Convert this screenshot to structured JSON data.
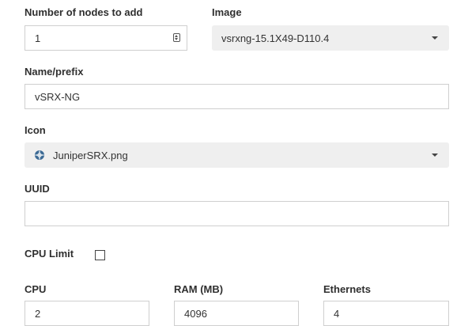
{
  "form": {
    "nodes_count": {
      "label": "Number of nodes to add",
      "value": "1"
    },
    "image": {
      "label": "Image",
      "value": "vsrxng-15.1X49-D110.4"
    },
    "name_prefix": {
      "label": "Name/prefix",
      "value": "vSRX-NG"
    },
    "icon": {
      "label": "Icon",
      "value": "JuniperSRX.png",
      "icon_name": "globe-network-icon"
    },
    "uuid": {
      "label": "UUID",
      "value": ""
    },
    "cpu_limit": {
      "label": "CPU Limit",
      "checked": false
    },
    "cpu": {
      "label": "CPU",
      "value": "2"
    },
    "ram": {
      "label": "RAM (MB)",
      "value": "4096"
    },
    "ethernets": {
      "label": "Ethernets",
      "value": "4"
    }
  },
  "colors": {
    "select_bg": "#efefef",
    "border": "#cfcfcf",
    "icon_blue": "#3c6a95"
  }
}
